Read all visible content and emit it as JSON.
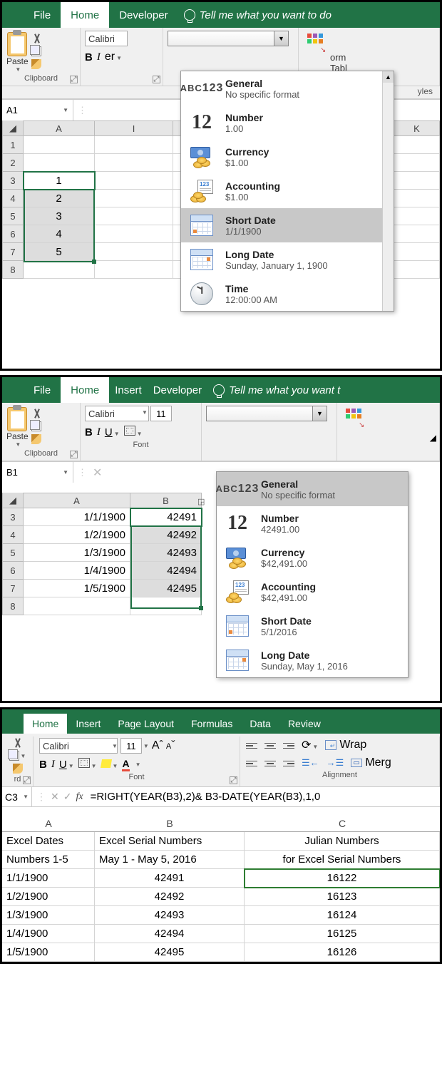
{
  "panel1": {
    "tabs": [
      "File",
      "Home",
      "Developer"
    ],
    "active_tab": "Home",
    "tell_me": "Tell me what you want to do",
    "paste_label": "Paste",
    "group_clipboard": "Clipboard",
    "font_name": "Calibri",
    "bold": "B",
    "italic": "I",
    "er": "er",
    "right_text1": "orm",
    "right_text2": "Tabl",
    "group_styles": "yles",
    "namebox": "A1",
    "col_headers": [
      "A",
      "I",
      "K"
    ],
    "row_numbers": [
      "1",
      "2",
      "3",
      "4",
      "5",
      "6",
      "7",
      "8"
    ],
    "cells_A": [
      "",
      "",
      "1",
      "2",
      "3",
      "4",
      "5",
      ""
    ],
    "fmt_dropdown": [
      {
        "title": "General",
        "sub": "No specific format",
        "icon": "general"
      },
      {
        "title": "Number",
        "sub": "1.00",
        "icon": "number"
      },
      {
        "title": "Currency",
        "sub": "$1.00",
        "icon": "currency"
      },
      {
        "title": "Accounting",
        "sub": " $1.00",
        "icon": "accounting"
      },
      {
        "title": "Short Date",
        "sub": "1/1/1900",
        "icon": "shortdate",
        "sel": true
      },
      {
        "title": "Long Date",
        "sub": "Sunday, January 1, 1900",
        "icon": "longdate"
      },
      {
        "title": "Time",
        "sub": "12:00:00 AM",
        "icon": "time"
      }
    ]
  },
  "panel2": {
    "tabs": [
      "File",
      "Home",
      "Insert",
      "Developer"
    ],
    "active_tab": "Home",
    "tell_me": "Tell me what you want t",
    "paste_label": "Paste",
    "group_clipboard": "Clipboard",
    "group_font": "Font",
    "font_name": "Calibri",
    "font_size": "11",
    "bold": "B",
    "italic": "I",
    "underline": "U",
    "namebox": "B1",
    "col_headers": [
      "A",
      "B"
    ],
    "row_numbers": [
      "3",
      "4",
      "5",
      "6",
      "7",
      "8"
    ],
    "cells_A": [
      "1/1/1900",
      "1/2/1900",
      "1/3/1900",
      "1/4/1900",
      "1/5/1900",
      ""
    ],
    "cells_B": [
      "42491",
      "42492",
      "42493",
      "42494",
      "42495",
      ""
    ],
    "fmt_dropdown": [
      {
        "title": "General",
        "sub": "No specific format",
        "icon": "general",
        "sel": true
      },
      {
        "title": "Number",
        "sub": "42491.00",
        "icon": "number"
      },
      {
        "title": "Currency",
        "sub": "$42,491.00",
        "icon": "currency"
      },
      {
        "title": "Accounting",
        "sub": " $42,491.00",
        "icon": "accounting"
      },
      {
        "title": "Short Date",
        "sub": "5/1/2016",
        "icon": "shortdate"
      },
      {
        "title": "Long Date",
        "sub": "Sunday, May 1, 2016",
        "icon": "longdate"
      }
    ]
  },
  "panel3": {
    "tabs": [
      "Home",
      "Insert",
      "Page Layout",
      "Formulas",
      "Data",
      "Review"
    ],
    "active_tab": "Home",
    "font_name": "Calibri",
    "font_size": "11",
    "bold": "B",
    "italic": "I",
    "underline": "U",
    "group_rd": "rd",
    "group_font": "Font",
    "group_align": "Alignment",
    "wrap_label": "Wrap",
    "merge_label": "Merg",
    "namebox": "C3",
    "formula": "=RIGHT(YEAR(B3),2)& B3-DATE(YEAR(B3),1,0",
    "col_headers": [
      "A",
      "B",
      "C"
    ],
    "hdr1": [
      "Excel Dates",
      "Excel Serial Numbers",
      "Julian Numbers"
    ],
    "hdr2": [
      "Numbers 1-5",
      "May 1 - May 5, 2016",
      "for Excel Serial Numbers"
    ],
    "rows": [
      [
        "1/1/1900",
        "42491",
        "16122"
      ],
      [
        "1/2/1900",
        "42492",
        "16123"
      ],
      [
        "1/3/1900",
        "42493",
        "16124"
      ],
      [
        "1/4/1900",
        "42494",
        "16125"
      ],
      [
        "1/5/1900",
        "42495",
        "16126"
      ]
    ]
  }
}
